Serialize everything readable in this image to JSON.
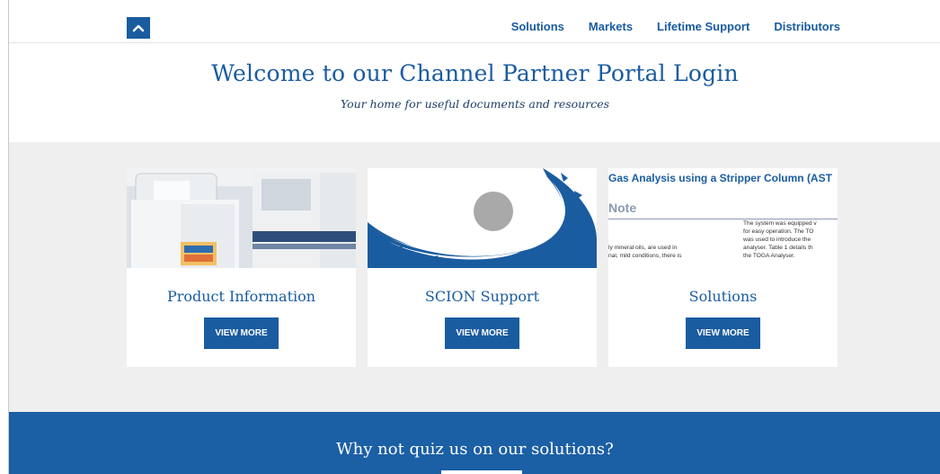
{
  "nav": {
    "items": [
      {
        "label": "Solutions"
      },
      {
        "label": "Markets"
      },
      {
        "label": "Lifetime Support"
      },
      {
        "label": "Distributors"
      }
    ]
  },
  "hero": {
    "title": "Welcome to our Channel Partner Portal Login",
    "subtitle": "Your home for useful documents and resources"
  },
  "cards": [
    {
      "title": "Product Information",
      "button": "VIEW MORE"
    },
    {
      "title": "SCION Support",
      "button": "VIEW MORE"
    },
    {
      "title": "Solutions",
      "button": "VIEW MORE",
      "doc": {
        "heading": "Gas Analysis using a Stripper Column (AST",
        "note": "Note",
        "left_lines": [
          "ly mineral oils, are used in",
          "nal, mild conditions, there is"
        ],
        "right_lines": [
          "The system was equipped v",
          "for easy operation. The TO",
          "was used to introduce the",
          "analyser. Table 1 details th",
          "the TOGA Analyser."
        ]
      }
    }
  ],
  "banner": {
    "text": "Why not quiz us on our solutions?"
  },
  "colors": {
    "brand_blue": "#1a5ca0",
    "banner_blue": "#1b5fa5",
    "section_gray": "#efefef"
  },
  "icons": {
    "logo": "chevron-up-icon"
  }
}
